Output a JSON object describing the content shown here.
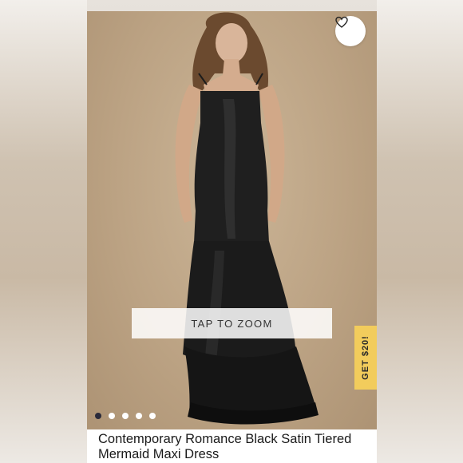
{
  "product": {
    "title": "Contemporary Romance Black Satin Tiered Mermaid Maxi Dress"
  },
  "gallery": {
    "zoom_label": "TAP TO ZOOM",
    "image_count": 5,
    "active_index": 0
  },
  "promo": {
    "label": "GET $20!"
  },
  "icons": {
    "favorite": "heart-icon"
  },
  "colors": {
    "promo_background": "#f2cc5c",
    "active_dot": "#2a2a3a"
  }
}
